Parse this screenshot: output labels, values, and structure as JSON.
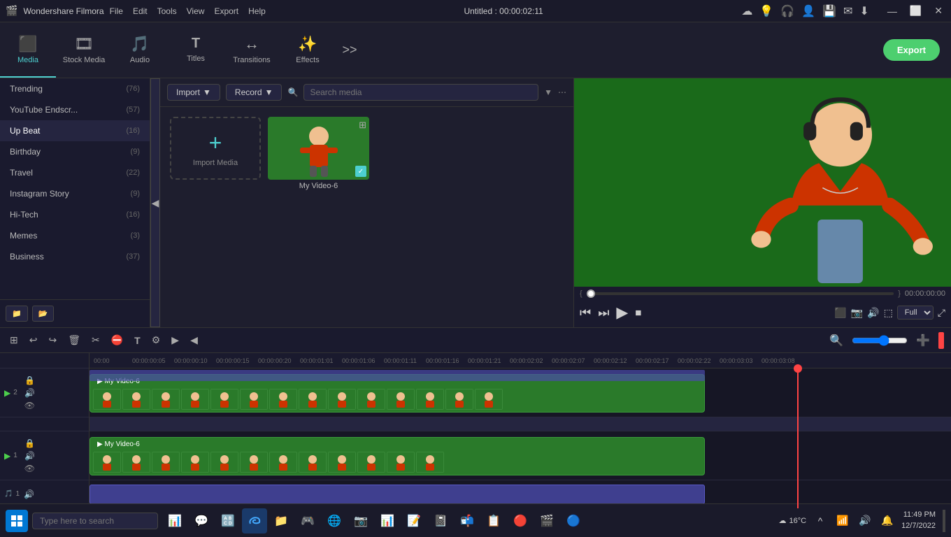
{
  "app": {
    "name": "Wondershare Filmora",
    "logo": "🎬"
  },
  "titlebar": {
    "menus": [
      "File",
      "Edit",
      "Tools",
      "View",
      "Export",
      "Help"
    ],
    "title": "Untitled : 00:00:02:11",
    "icons": [
      "☁",
      "💡",
      "🎧",
      "👤",
      "💾",
      "✉",
      "⬇"
    ],
    "win_controls": [
      "—",
      "⬜",
      "✕"
    ]
  },
  "toolbar": {
    "items": [
      {
        "id": "media",
        "label": "Media",
        "icon": "⬛",
        "active": true
      },
      {
        "id": "stock-media",
        "label": "Stock Media",
        "icon": "🎞"
      },
      {
        "id": "audio",
        "label": "Audio",
        "icon": "🎵"
      },
      {
        "id": "titles",
        "label": "Titles",
        "icon": "T"
      },
      {
        "id": "transitions",
        "label": "Transitions",
        "icon": "↔"
      },
      {
        "id": "effects",
        "label": "Effects",
        "icon": "✨"
      }
    ],
    "more_label": ">>",
    "export_label": "Export"
  },
  "left_panel": {
    "items": [
      {
        "label": "Trending",
        "count": 76
      },
      {
        "label": "YouTube Endscr...",
        "count": 57
      },
      {
        "label": "Up Beat",
        "count": 16
      },
      {
        "label": "Birthday",
        "count": 9
      },
      {
        "label": "Travel",
        "count": 22
      },
      {
        "label": "Instagram Story",
        "count": 9
      },
      {
        "label": "Hi-Tech",
        "count": 16
      },
      {
        "label": "Memes",
        "count": 3
      },
      {
        "label": "Business",
        "count": 37
      }
    ],
    "footer_btns": [
      "📁",
      "📂"
    ]
  },
  "media_panel": {
    "import_label": "Import",
    "record_label": "Record",
    "search_placeholder": "Search media",
    "import_media_label": "Import Media",
    "items": [
      {
        "label": "My Video-6",
        "checked": true
      }
    ]
  },
  "preview": {
    "time_current": "00:00:00:00",
    "quality": "Full",
    "btns": [
      "⏮",
      "⏭",
      "▶",
      "⏹"
    ]
  },
  "timeline": {
    "toolbar_btns": [
      "⊞",
      "↩",
      "↪",
      "🗑",
      "✂",
      "⛔",
      "T",
      "⚙",
      "▶",
      "◀"
    ],
    "ruler_marks": [
      "00:00",
      "00:00:00:05",
      "00:00:00:10",
      "00:00:00:15",
      "00:00:00:20",
      "00:00:01:01",
      "00:00:01:06",
      "00:00:01:11",
      "00:00:01:16",
      "00:00:01:21",
      "00:00:02:02",
      "00:00:02:07",
      "00:00:02:12",
      "00:00:02:17",
      "00:00:02:22",
      "00:00:03:03",
      "00:00:03:08"
    ],
    "tracks": [
      {
        "id": "v2",
        "type": "video",
        "label": "V2",
        "clip_label": "My Video-6"
      },
      {
        "id": "v1",
        "type": "video",
        "label": "V1",
        "clip_label": "My Video-6"
      },
      {
        "id": "a1",
        "type": "audio",
        "label": "A1"
      }
    ]
  },
  "taskbar": {
    "search_placeholder": "Type here to search",
    "apps": [
      "🪟",
      "🔍",
      "💬",
      "📋",
      "🔠",
      "📦",
      "🌐",
      "📁",
      "🎮",
      "🌐",
      "📊",
      "📝",
      "📓",
      "🗂",
      "🎬",
      "📊",
      "🌏",
      "🔒"
    ],
    "system_icons": [
      "🔔",
      "🔊",
      "🌐"
    ],
    "time": "11:49 PM",
    "date": "12/7/2022",
    "weather": "16°C"
  }
}
